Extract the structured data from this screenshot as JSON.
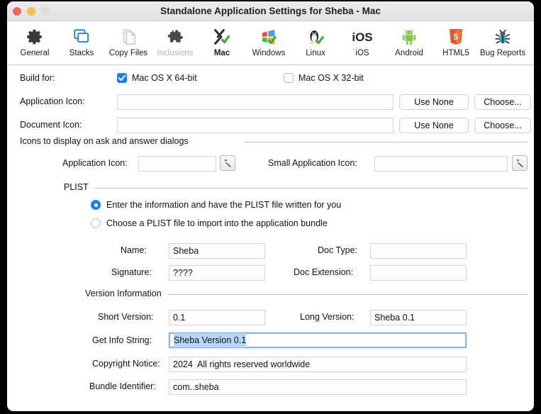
{
  "window": {
    "title": "Standalone Application Settings for Sheba - Mac",
    "traffic_lights": [
      "close-button",
      "minimize-button",
      "zoom-button"
    ]
  },
  "toolbar": {
    "items": [
      {
        "label": "General",
        "icon": "gear-icon",
        "state": "normal"
      },
      {
        "label": "Stacks",
        "icon": "stacks-icon",
        "state": "normal"
      },
      {
        "label": "Copy Files",
        "icon": "copy-files-icon",
        "state": "normal"
      },
      {
        "label": "Inclusions",
        "icon": "puzzle-icon",
        "state": "disabled"
      },
      {
        "label": "Mac",
        "icon": "mac-x-icon",
        "state": "selected"
      },
      {
        "label": "Windows",
        "icon": "windows-icon",
        "state": "normal"
      },
      {
        "label": "Linux",
        "icon": "linux-penguin-icon",
        "state": "normal"
      },
      {
        "label": "iOS",
        "icon": "ios-icon",
        "state": "normal"
      },
      {
        "label": "Android",
        "icon": "android-icon",
        "state": "normal"
      },
      {
        "label": "HTML5",
        "icon": "html5-icon",
        "state": "normal"
      },
      {
        "label": "Bug Reports",
        "icon": "bug-icon",
        "state": "normal"
      }
    ]
  },
  "build_for": {
    "label": "Build for:",
    "options": [
      {
        "label": "Mac OS X 64-bit",
        "checked": true
      },
      {
        "label": "Mac OS X 32-bit",
        "checked": false
      }
    ]
  },
  "icons": {
    "application_icon": {
      "label": "Application Icon:",
      "value": "",
      "use_none": "Use None",
      "choose": "Choose..."
    },
    "document_icon": {
      "label": "Document Icon:",
      "value": "",
      "use_none": "Use None",
      "choose": "Choose..."
    }
  },
  "dialog_icons": {
    "section_label": "Icons to display on ask and answer dialogs",
    "application_icon": {
      "label": "Application Icon:",
      "value": ""
    },
    "small_application_icon": {
      "label": "Small Application Icon:",
      "value": ""
    },
    "wand_icon": "magic-wand-icon"
  },
  "plist": {
    "section_label": "PLIST",
    "options": [
      {
        "label": "Enter the information and have the PLIST file written for you",
        "selected": true
      },
      {
        "label": "Choose a PLIST file to import into the application bundle",
        "selected": false
      }
    ],
    "fields": {
      "name": {
        "label": "Name:",
        "value": "Sheba"
      },
      "doc_type": {
        "label": "Doc Type:",
        "value": ""
      },
      "signature": {
        "label": "Signature:",
        "value": "????"
      },
      "doc_extension": {
        "label": "Doc Extension:",
        "value": ""
      }
    }
  },
  "version_info": {
    "section_label": "Version Information",
    "short_version": {
      "label": "Short Version:",
      "value": "0.1"
    },
    "long_version": {
      "label": "Long Version:",
      "value": "Sheba 0.1"
    },
    "get_info_string": {
      "label": "Get Info String:",
      "value": "Sheba Version 0.1",
      "focused": true,
      "selected": true
    },
    "copyright_notice": {
      "label": "Copyright Notice:",
      "value": "2024  All rights reserved worldwide"
    },
    "bundle_identifier": {
      "label": "Bundle Identifier:",
      "value": "com..sheba"
    }
  },
  "colors": {
    "accent": "#1b7ef6",
    "selection": "#b6d6fb",
    "focus_border": "#8ab4e8",
    "titlebar": "#e8e8e8"
  }
}
